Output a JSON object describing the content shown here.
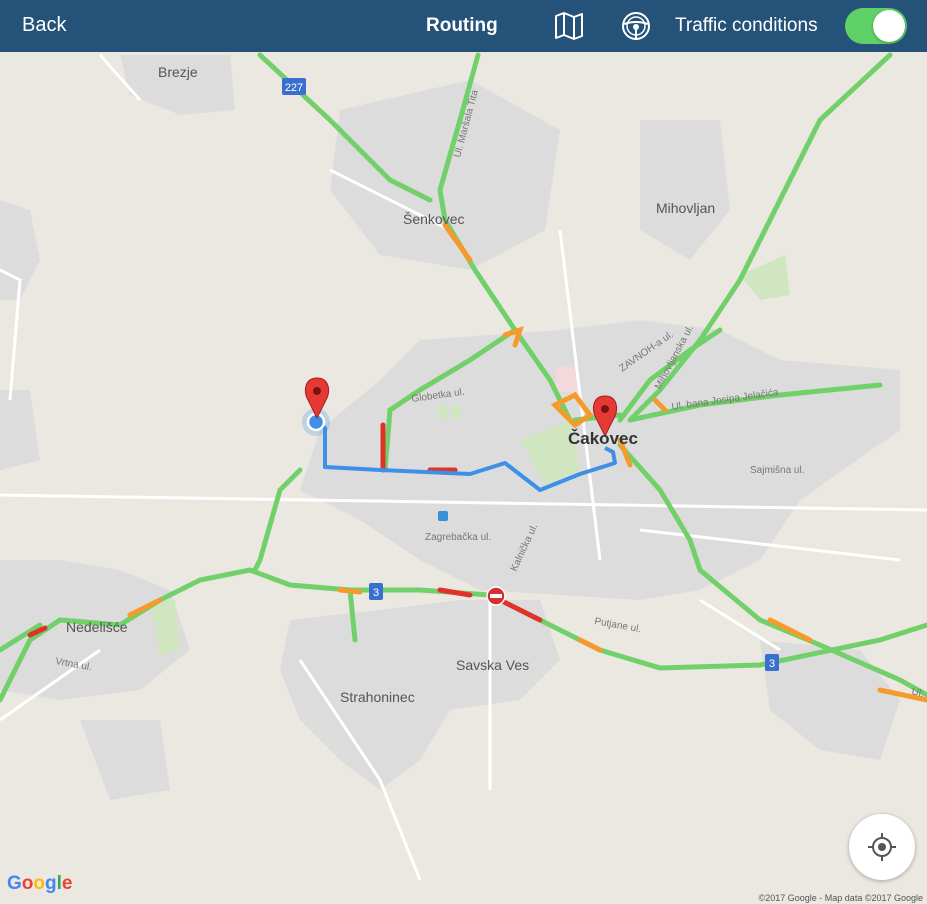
{
  "header": {
    "back_label": "Back",
    "title": "Routing",
    "map_icon": "map-icon",
    "steering_icon": "steering-wheel-icon",
    "traffic_label": "Traffic conditions",
    "traffic_enabled": true
  },
  "map": {
    "places": {
      "brezje": "Brezje",
      "senkovec": "Šenkovec",
      "mihovljan": "Mihovljan",
      "cakovec": "Čakovec",
      "nedelisce": "Nedelišće",
      "savska_ves": "Savska Ves",
      "strahoninec": "Strahoninec"
    },
    "streets": {
      "marsala_tita": "Ul. Maršala Tita",
      "globetka": "Globetka ul.",
      "zavnoh": "ZAVNOH-a ul.",
      "mihovljanska": "Mihovljanska ul.",
      "jelacica": "Ul. bana Josipa Jelačića",
      "sajmisna": "Sajmišna ul.",
      "zagrebacka": "Zagrebačka ul.",
      "kalnicka": "Kalnička ul.",
      "putjane": "Putjane ul.",
      "vrtna": "Vrtna ul.",
      "ul": "Ul."
    },
    "road_shields": {
      "r227": "227",
      "r3a": "3",
      "r3b": "3"
    },
    "colors": {
      "route": "#3d8fe8",
      "traffic_free": "#72d06a",
      "traffic_slow": "#f59a2b",
      "traffic_jam": "#e0312b",
      "header_bg": "#255279",
      "toggle_on": "#5fd166"
    }
  },
  "controls": {
    "locate_icon": "my-location-icon"
  },
  "attribution": {
    "logo": "Google",
    "copyright": "©2017 Google - Map data ©2017 Google"
  }
}
